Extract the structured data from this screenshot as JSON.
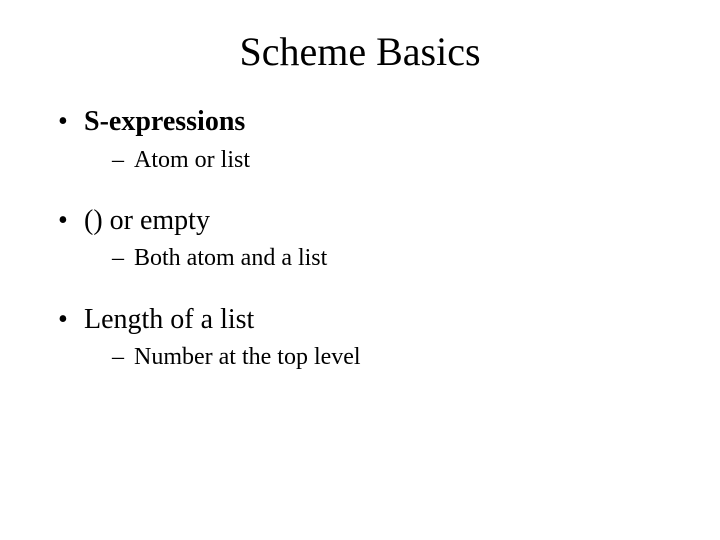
{
  "title": "Scheme Basics",
  "items": [
    {
      "label": "S-expressions",
      "bold": true,
      "sub": {
        "label": "Atom or list",
        "extraIndent": true
      }
    },
    {
      "label": "() or empty",
      "bold": false,
      "sub": {
        "label": "Both atom and a list",
        "extraIndent": false
      }
    },
    {
      "label": "Length of a list",
      "bold": false,
      "sub": {
        "label": "Number at the top level",
        "extraIndent": false
      }
    }
  ]
}
